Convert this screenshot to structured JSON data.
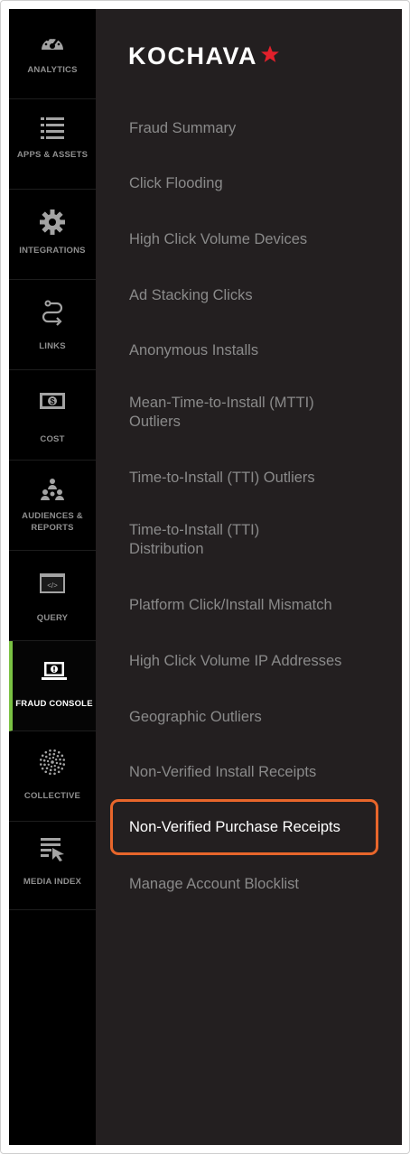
{
  "rail": {
    "items": [
      {
        "label": "ANALYTICS",
        "icon": "gauge-icon"
      },
      {
        "label": "APPS & ASSETS",
        "icon": "list-icon"
      },
      {
        "label": "INTEGRATIONS",
        "icon": "gear-icon"
      },
      {
        "label": "LINKS",
        "icon": "path-link-icon"
      },
      {
        "label": "COST",
        "icon": "dollar-bill-icon"
      },
      {
        "label": "AUDIENCES & REPORTS",
        "icon": "people-network-icon"
      },
      {
        "label": "QUERY",
        "icon": "code-window-icon"
      },
      {
        "label": "FRAUD CONSOLE",
        "icon": "laptop-alert-icon",
        "active": true
      },
      {
        "label": "COLLECTIVE",
        "icon": "dotted-circle-icon"
      },
      {
        "label": "MEDIA INDEX",
        "icon": "list-cursor-icon"
      }
    ],
    "accent_color": "#7ac143"
  },
  "brand": {
    "name": "KOCHAVA",
    "star_color": "#e2202b"
  },
  "menu": {
    "items": [
      {
        "label": "Fraud Summary"
      },
      {
        "label": "Click Flooding"
      },
      {
        "label": "High Click Volume Devices"
      },
      {
        "label": "Ad Stacking Clicks"
      },
      {
        "label": "Anonymous Installs"
      },
      {
        "label": "Mean-Time-to-Install (MTTI)",
        "label2": "Outliers"
      },
      {
        "label": "Time-to-Install (TTI) Outliers"
      },
      {
        "label": "Time-to-Install (TTI)",
        "label2": "Distribution"
      },
      {
        "label": "Platform Click/Install Mismatch"
      },
      {
        "label": "High Click Volume IP Addresses"
      },
      {
        "label": "Geographic Outliers"
      },
      {
        "label": "Non-Verified Install Receipts"
      },
      {
        "label": "Non-Verified Purchase Receipts",
        "highlighted": true
      },
      {
        "label": "Manage Account Blocklist"
      }
    ],
    "highlight_color": "#e8662b"
  }
}
